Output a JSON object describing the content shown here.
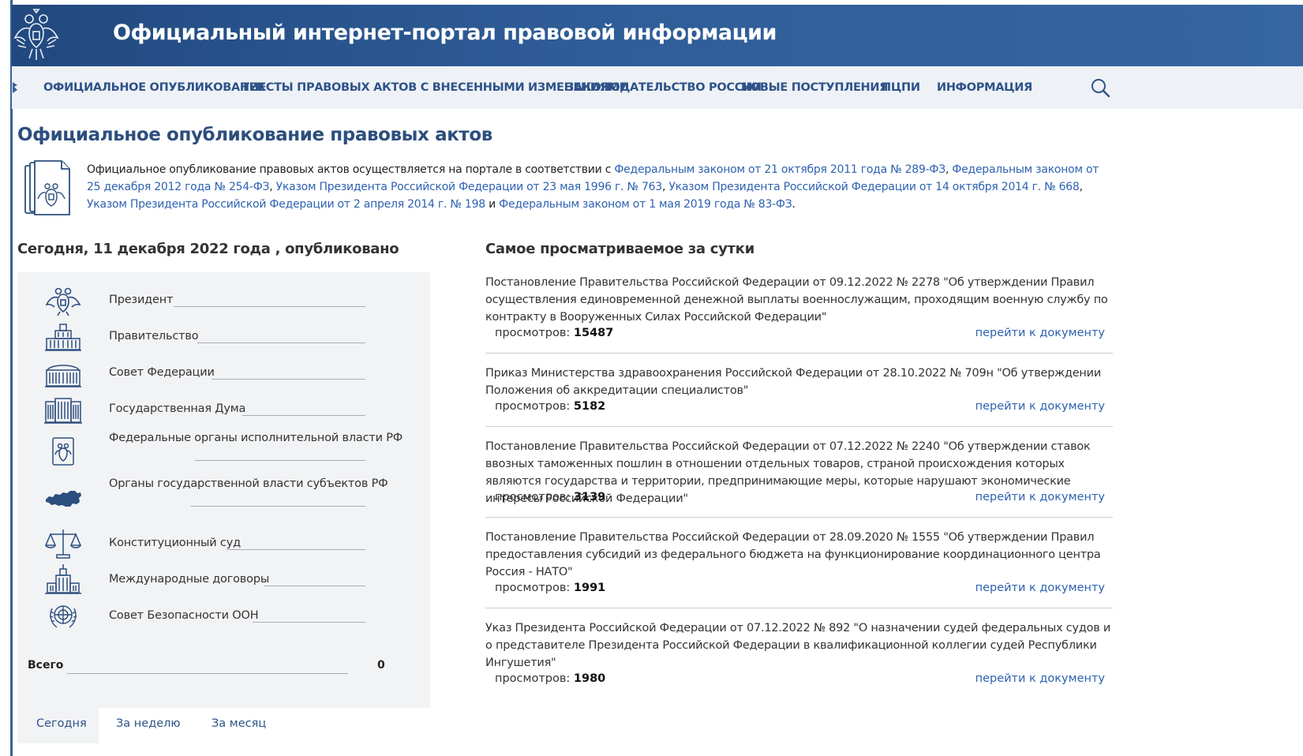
{
  "header": {
    "site_title": "Официальный интернет-портал правовой информации"
  },
  "nav": {
    "items": [
      "ОФИЦИАЛЬНОЕ ОПУБЛИКОВАНИЕ",
      "ТЕКСТЫ ПРАВОВЫХ АКТОВ С ВНЕСЕННЫМИ ИЗМЕНЕНИЯМИ",
      "ЗАКОНОДАТЕЛЬСТВО РОССИИ",
      "НОВЫЕ ПОСТУПЛЕНИЯ",
      "ПЦПИ",
      "ИНФОРМАЦИЯ"
    ]
  },
  "page": {
    "title": "Официальное опубликование правовых актов",
    "intro_text": "Официальное опубликование правовых актов осуществляется на портале в соответствии с ",
    "intro_links": [
      "Федеральным  законом от 21 октября 2011 года № 289-ФЗ",
      "Федеральным законом от 25 декабря 2012 года № 254-ФЗ",
      "Указом Президента Российской Федерации от 23 мая 1996 г. № 763",
      "Указом Президента Российской Федерации от 14 октября 2014 г. № 668",
      "Указом Президента Российской Федерации от 2 апреля 2014 г. № 198",
      "Федеральным законом от 1 мая 2019 года № 83-ФЗ"
    ],
    "comma": ", ",
    "and": " и ",
    "period": "."
  },
  "today": {
    "title": "Сегодня, 11 декабря 2022 года , опубликовано",
    "stats": [
      {
        "label": "Президент",
        "icon": "eagle-icon"
      },
      {
        "label": "Правительство",
        "icon": "government-building-icon"
      },
      {
        "label": "Совет Федерации",
        "icon": "federation-council-icon"
      },
      {
        "label": "Государственная Дума",
        "icon": "state-duma-icon"
      },
      {
        "label": "Федеральные органы исполнительной власти РФ",
        "icon": "emblem-shield-icon"
      },
      {
        "label": "Органы государственной власти субъектов РФ",
        "icon": "russia-map-icon"
      },
      {
        "label": "Конституционный суд",
        "icon": "scales-icon"
      },
      {
        "label": "Международные договоры",
        "icon": "tower-building-icon"
      },
      {
        "label": "Совет Безопасности ООН",
        "icon": "un-emblem-icon"
      }
    ],
    "total_label": "Всего",
    "total_value": "0",
    "tabs": [
      "Сегодня",
      "За неделю",
      "За месяц"
    ]
  },
  "popular": {
    "title": "Самое просматриваемое за сутки",
    "views_label": "просмотров: ",
    "open_label": "перейти к документу",
    "docs": [
      {
        "text": "Постановление Правительства Российской Федерации от 09.12.2022 № 2278 \"Об утверждении Правил осуществления единовременной денежной выплаты военнослужащим, проходящим военную службу по контракту в Вооруженных Силах Российской Федерации\"",
        "views": "15487"
      },
      {
        "text": "Приказ Министерства здравоохранения Российской Федерации от 28.10.2022 № 709н \"Об утверждении Положения об аккредитации специалистов\"",
        "views": "5182"
      },
      {
        "text": "Постановление Правительства Российской Федерации от 07.12.2022 № 2240 \"Об утверждении ставок ввозных таможенных пошлин в отношении отдельных товаров, страной происхождения которых являются государства и территории, предпринимающие меры, которые нарушают экономические интересы Российской Федерации\"",
        "views": "3139"
      },
      {
        "text": "Постановление Правительства Российской Федерации от 28.09.2020 № 1555 \"Об утверждении Правил предоставления субсидий из федерального бюджета на функционирование координационного центра Россия - НАТО\"",
        "views": "1991"
      },
      {
        "text": "Указ Президента Российской Федерации от 07.12.2022 № 892 \"О назначении судей федеральных судов и о представителе Президента Российской Федерации в квалификационной коллегии судей Республики Ингушетия\"",
        "views": "1980"
      }
    ]
  }
}
